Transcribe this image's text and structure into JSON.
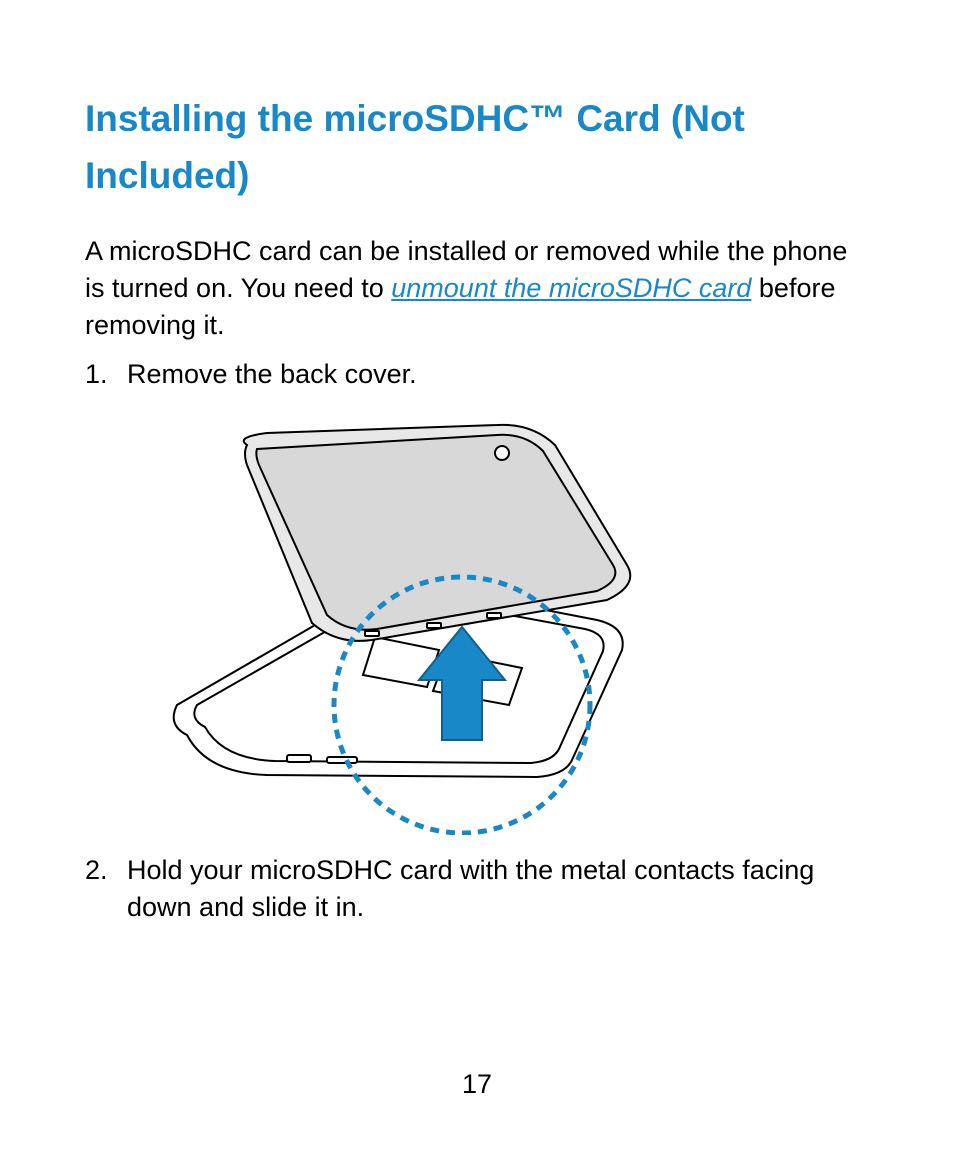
{
  "heading": "Installing the microSDHC™ Card (Not Included)",
  "intro": {
    "before": "A microSDHC card can be installed or removed while the phone is turned on. You need to ",
    "link": "unmount the microSDHC card",
    "after": " before removing it."
  },
  "steps": [
    {
      "num": "1.",
      "text": "Remove the back cover."
    },
    {
      "num": "2.",
      "text": "Hold your microSDHC card with the metal contacts facing down and slide it in."
    }
  ],
  "pageNumber": "17"
}
